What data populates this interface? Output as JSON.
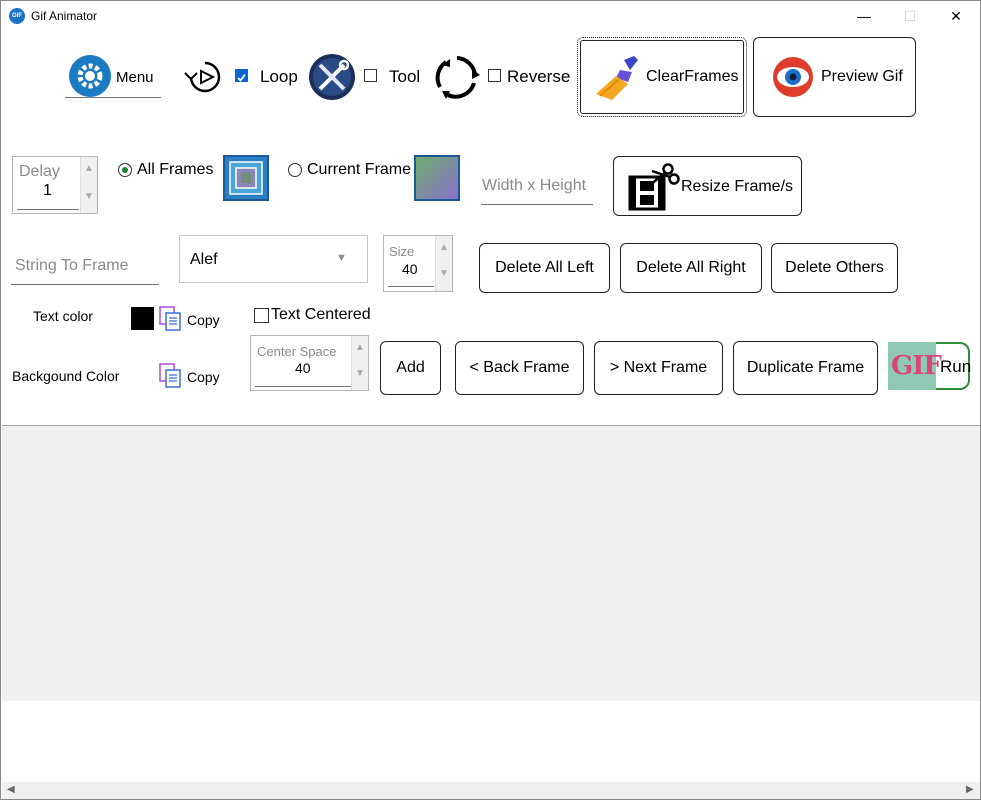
{
  "window": {
    "title": "Gif Animator",
    "app_icon_text": "GIF"
  },
  "toolbar": {
    "menu_label": "Menu",
    "loop_label": "Loop",
    "loop_checked": true,
    "tool_label": "Tool",
    "tool_checked": false,
    "reverse_label": "Reverse",
    "reverse_checked": false,
    "clear_frames_label": "ClearFrames",
    "preview_gif_label": "Preview Gif"
  },
  "delay": {
    "label": "Delay",
    "value": "1"
  },
  "frames_scope": {
    "all_frames_label": "All Frames",
    "current_frame_label": "Current Frame",
    "selected": "all"
  },
  "resize": {
    "placeholder": "Width x Height",
    "button_label": "Resize Frame/s"
  },
  "text_input": {
    "placeholder": "String To Frame"
  },
  "font_select": {
    "value": "Alef"
  },
  "size": {
    "label": "Size",
    "value": "40"
  },
  "delete": {
    "all_left": "Delete All Left",
    "all_right": "Delete All Right",
    "others": "Delete Others"
  },
  "text_color": {
    "label": "Text color",
    "copy_label": "Copy",
    "swatch": "#000000"
  },
  "text_centered": {
    "label": "Text Centered",
    "checked": false
  },
  "background_color": {
    "label": "Backgound Color",
    "copy_label": "Copy"
  },
  "center_space": {
    "label": "Center Space",
    "value": "40"
  },
  "actions": {
    "add": "Add",
    "back_frame": "< Back Frame",
    "next_frame": "> Next Frame",
    "duplicate_frame": "Duplicate Frame",
    "run": "Run",
    "run_icon_text": "GIF"
  }
}
